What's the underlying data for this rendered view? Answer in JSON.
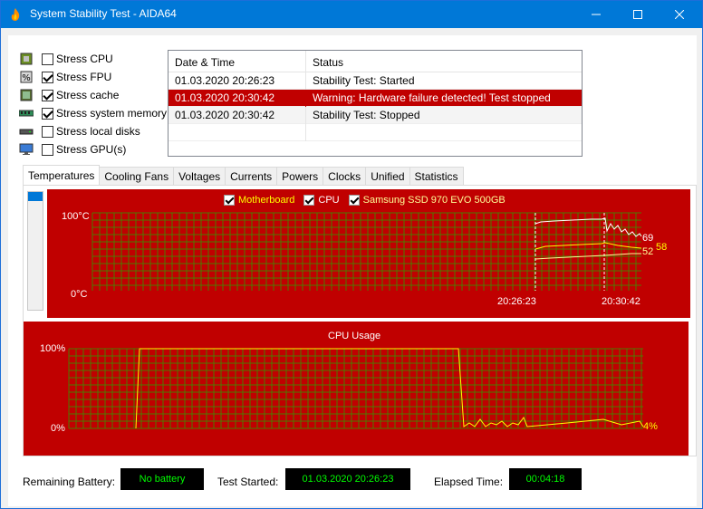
{
  "window": {
    "title": "System Stability Test - AIDA64",
    "minimize_glyph": "—",
    "maximize_glyph": "☐",
    "close_glyph": "✕"
  },
  "stress_options": [
    {
      "label": "Stress CPU",
      "checked": false,
      "icon": "cpu-chip-icon"
    },
    {
      "label": "Stress FPU",
      "checked": true,
      "icon": "fpu-percent-icon"
    },
    {
      "label": "Stress cache",
      "checked": true,
      "icon": "cache-chip-icon"
    },
    {
      "label": "Stress system memory",
      "checked": true,
      "icon": "memory-module-icon"
    },
    {
      "label": "Stress local disks",
      "checked": false,
      "icon": "disk-drive-icon"
    },
    {
      "label": "Stress GPU(s)",
      "checked": false,
      "icon": "monitor-icon"
    }
  ],
  "log": {
    "columns": [
      "Date & Time",
      "Status"
    ],
    "rows": [
      {
        "time": "01.03.2020 20:26:23",
        "status": "Stability Test: Started",
        "highlight": false
      },
      {
        "time": "01.03.2020 20:30:42",
        "status": "Warning: Hardware failure detected! Test stopped",
        "highlight": true
      },
      {
        "time": "01.03.2020 20:30:42",
        "status": "Stability Test: Stopped",
        "highlight": false
      }
    ]
  },
  "tabs": [
    "Temperatures",
    "Cooling Fans",
    "Voltages",
    "Currents",
    "Powers",
    "Clocks",
    "Unified",
    "Statistics"
  ],
  "active_tab": "Temperatures",
  "colors": {
    "chart_bg": "#c00000",
    "grid": "#4d7a00",
    "motherboard": "#ffff00",
    "cpu": "#ffffff",
    "ssd": "#ffff99",
    "cpu_usage": "#ffff00",
    "status_value": "#00ff00"
  },
  "temp_chart": {
    "legend": [
      {
        "label": "Motherboard",
        "color": "#ffff00"
      },
      {
        "label": "CPU",
        "color": "#ffffff"
      },
      {
        "label": "Samsung SSD 970 EVO 500GB",
        "color": "#ffff99"
      }
    ],
    "y_max_label": "100°C",
    "y_min_label": "0°C",
    "x_labels": [
      "20:26:23",
      "20:30:42"
    ],
    "end_values": [
      "69",
      "58",
      "52"
    ]
  },
  "cpu_chart": {
    "title": "CPU Usage",
    "y_max_label": "100%",
    "y_min_label": "0%",
    "end_value": "4%"
  },
  "chart_data": [
    {
      "type": "line",
      "ylim": [
        0,
        100
      ],
      "x": [
        "20:26:23",
        "20:30:42"
      ],
      "series": [
        {
          "name": "CPU",
          "values": [
            85,
            95,
            69
          ]
        },
        {
          "name": "Motherboard",
          "values": [
            48,
            58,
            58
          ]
        },
        {
          "name": "Samsung SSD 970 EVO 500GB",
          "values": [
            40,
            48,
            52
          ]
        }
      ]
    },
    {
      "type": "line",
      "title": "CPU Usage",
      "ylim": [
        0,
        100
      ],
      "series": [
        {
          "name": "CPU Usage",
          "values": [
            2,
            100,
            100,
            100,
            3,
            5,
            4
          ]
        }
      ]
    }
  ],
  "status_bar": {
    "battery_label": "Remaining Battery:",
    "battery_value": "No battery",
    "started_label": "Test Started:",
    "started_value": "01.03.2020 20:26:23",
    "elapsed_label": "Elapsed Time:",
    "elapsed_value": "00:04:18"
  }
}
